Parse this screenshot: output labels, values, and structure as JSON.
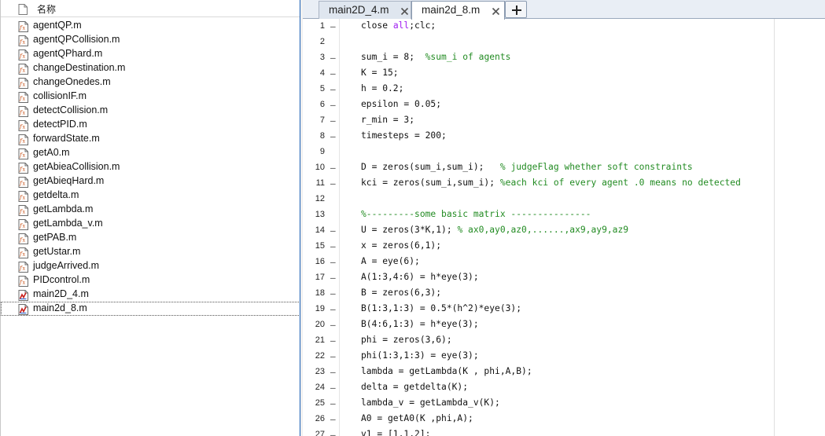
{
  "colors": {
    "keyword": "#a020f0",
    "comment": "#228b22",
    "text": "#111111",
    "tab_active": "#ffffff",
    "tab_inactive": "#dfe6ef",
    "splitter_accent": "#1a5fb4"
  },
  "file_browser": {
    "header": {
      "label": "名称",
      "icon": "file-icon"
    },
    "files": [
      {
        "name": "agentQP.m",
        "icon": "matlab-function-file-icon"
      },
      {
        "name": "agentQPCollision.m",
        "icon": "matlab-function-file-icon"
      },
      {
        "name": "agentQPhard.m",
        "icon": "matlab-function-file-icon"
      },
      {
        "name": "changeDestination.m",
        "icon": "matlab-function-file-icon"
      },
      {
        "name": "changeOnedes.m",
        "icon": "matlab-function-file-icon"
      },
      {
        "name": "collisionIF.m",
        "icon": "matlab-function-file-icon"
      },
      {
        "name": "detectCollision.m",
        "icon": "matlab-function-file-icon"
      },
      {
        "name": "detectPID.m",
        "icon": "matlab-function-file-icon"
      },
      {
        "name": "forwardState.m",
        "icon": "matlab-function-file-icon"
      },
      {
        "name": "getA0.m",
        "icon": "matlab-function-file-icon"
      },
      {
        "name": "getAbieaCollision.m",
        "icon": "matlab-function-file-icon"
      },
      {
        "name": "getAbieqHard.m",
        "icon": "matlab-function-file-icon"
      },
      {
        "name": "getdelta.m",
        "icon": "matlab-function-file-icon"
      },
      {
        "name": "getLambda.m",
        "icon": "matlab-function-file-icon"
      },
      {
        "name": "getLambda_v.m",
        "icon": "matlab-function-file-icon"
      },
      {
        "name": "getPAB.m",
        "icon": "matlab-function-file-icon"
      },
      {
        "name": "getUstar.m",
        "icon": "matlab-function-file-icon"
      },
      {
        "name": "judgeArrived.m",
        "icon": "matlab-function-file-icon"
      },
      {
        "name": "PIDcontrol.m",
        "icon": "matlab-function-file-icon"
      },
      {
        "name": "main2D_4.m",
        "icon": "matlab-script-file-icon"
      },
      {
        "name": "main2d_8.m",
        "icon": "matlab-script-file-icon",
        "selected": true
      }
    ]
  },
  "editor": {
    "tabs": [
      {
        "label": "main2D_4.m",
        "active": false
      },
      {
        "label": "main2d_8.m",
        "active": true
      }
    ],
    "add_tab_label": "+",
    "lines": [
      {
        "n": "1",
        "dash": "–",
        "segs": [
          [
            "close ",
            ""
          ],
          [
            "all",
            "kw"
          ],
          [
            ";clc;",
            ""
          ]
        ]
      },
      {
        "n": "2",
        "dash": "",
        "segs": []
      },
      {
        "n": "3",
        "dash": "–",
        "segs": [
          [
            "sum_i = 8;  ",
            ""
          ],
          [
            "%sum_i of agents",
            "cm"
          ]
        ]
      },
      {
        "n": "4",
        "dash": "–",
        "segs": [
          [
            "K = 15;",
            ""
          ]
        ]
      },
      {
        "n": "5",
        "dash": "–",
        "segs": [
          [
            "h = 0.2;",
            ""
          ]
        ]
      },
      {
        "n": "6",
        "dash": "–",
        "segs": [
          [
            "epsilon = 0.05;",
            ""
          ]
        ]
      },
      {
        "n": "7",
        "dash": "–",
        "segs": [
          [
            "r_min = 3;",
            ""
          ]
        ]
      },
      {
        "n": "8",
        "dash": "–",
        "segs": [
          [
            "timesteps = 200;",
            ""
          ]
        ]
      },
      {
        "n": "9",
        "dash": "",
        "segs": []
      },
      {
        "n": "10",
        "dash": "–",
        "segs": [
          [
            "D = zeros(sum_i,sum_i);   ",
            ""
          ],
          [
            "% judgeFlag whether soft constraints",
            "cm"
          ]
        ]
      },
      {
        "n": "11",
        "dash": "–",
        "segs": [
          [
            "kci = zeros(sum_i,sum_i); ",
            ""
          ],
          [
            "%each kci of every agent .0 means no detected",
            "cm"
          ]
        ]
      },
      {
        "n": "12",
        "dash": "",
        "segs": []
      },
      {
        "n": "13",
        "dash": "",
        "segs": [
          [
            "%---------some basic matrix ---------------",
            "cm"
          ]
        ]
      },
      {
        "n": "14",
        "dash": "–",
        "segs": [
          [
            "U = zeros(3*K,1); ",
            ""
          ],
          [
            "% ax0,ay0,az0,......,ax9,ay9,az9",
            "cm"
          ]
        ]
      },
      {
        "n": "15",
        "dash": "–",
        "segs": [
          [
            "x = zeros(6,1);",
            ""
          ]
        ]
      },
      {
        "n": "16",
        "dash": "–",
        "segs": [
          [
            "A = eye(6);",
            ""
          ]
        ]
      },
      {
        "n": "17",
        "dash": "–",
        "segs": [
          [
            "A(1:3,4:6) = h*eye(3);",
            ""
          ]
        ]
      },
      {
        "n": "18",
        "dash": "–",
        "segs": [
          [
            "B = zeros(6,3);",
            ""
          ]
        ]
      },
      {
        "n": "19",
        "dash": "–",
        "segs": [
          [
            "B(1:3,1:3) = 0.5*(h^2)*eye(3);",
            ""
          ]
        ]
      },
      {
        "n": "20",
        "dash": "–",
        "segs": [
          [
            "B(4:6,1:3) = h*eye(3);",
            ""
          ]
        ]
      },
      {
        "n": "21",
        "dash": "–",
        "segs": [
          [
            "phi = zeros(3,6);",
            ""
          ]
        ]
      },
      {
        "n": "22",
        "dash": "–",
        "segs": [
          [
            "phi(1:3,1:3) = eye(3);",
            ""
          ]
        ]
      },
      {
        "n": "23",
        "dash": "–",
        "segs": [
          [
            "lambda = getLambda(K , phi,A,B);",
            ""
          ]
        ]
      },
      {
        "n": "24",
        "dash": "–",
        "segs": [
          [
            "delta = getdelta(K);",
            ""
          ]
        ]
      },
      {
        "n": "25",
        "dash": "–",
        "segs": [
          [
            "lambda_v = getLambda_v(K);",
            ""
          ]
        ]
      },
      {
        "n": "26",
        "dash": "–",
        "segs": [
          [
            "A0 = getA0(K ,phi,A);",
            ""
          ]
        ]
      },
      {
        "n": "27",
        "dash": "–",
        "segs": [
          [
            "v1 = [1,1,2];",
            ""
          ]
        ]
      }
    ]
  }
}
